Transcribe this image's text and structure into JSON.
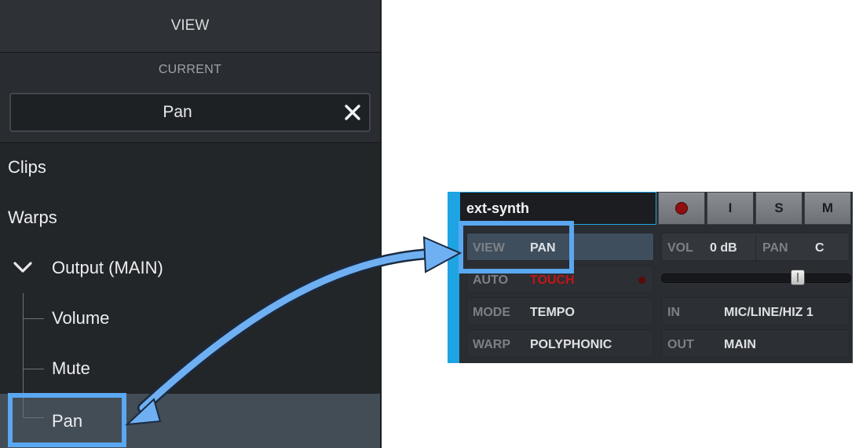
{
  "view_panel": {
    "header": "VIEW",
    "current_label": "CURRENT",
    "current_value": "Pan",
    "clear_icon": "close-icon",
    "items": [
      {
        "label": "Clips"
      },
      {
        "label": "Warps"
      },
      {
        "label": "Output (MAIN)",
        "expanded": true
      },
      {
        "label": "Volume"
      },
      {
        "label": "Mute"
      },
      {
        "label": "Pan",
        "selected": true
      }
    ]
  },
  "track": {
    "name": "ext-synth",
    "buttons": {
      "record_icon": "record-icon",
      "input": "I",
      "solo": "S",
      "mute": "M"
    },
    "rows": {
      "view": {
        "key": "VIEW",
        "value": "PAN"
      },
      "auto": {
        "key": "AUTO",
        "value": "TOUCH"
      },
      "mode": {
        "key": "MODE",
        "value": "TEMPO"
      },
      "warp": {
        "key": "WARP",
        "value": "POLYPHONIC"
      }
    },
    "vol": {
      "key": "VOL",
      "value": "0 dB"
    },
    "pan": {
      "key": "PAN",
      "value": "C"
    },
    "fader_level": 0.74,
    "io": {
      "in_key": "IN",
      "in_value": "MIC/LINE/HIZ 1",
      "out_key": "OUT",
      "out_value": "MAIN"
    }
  },
  "colors": {
    "accent": "#1fa4e3",
    "highlight": "#5aa7f2",
    "auto_touch": "#c41616",
    "selected_row": "#434d56"
  }
}
